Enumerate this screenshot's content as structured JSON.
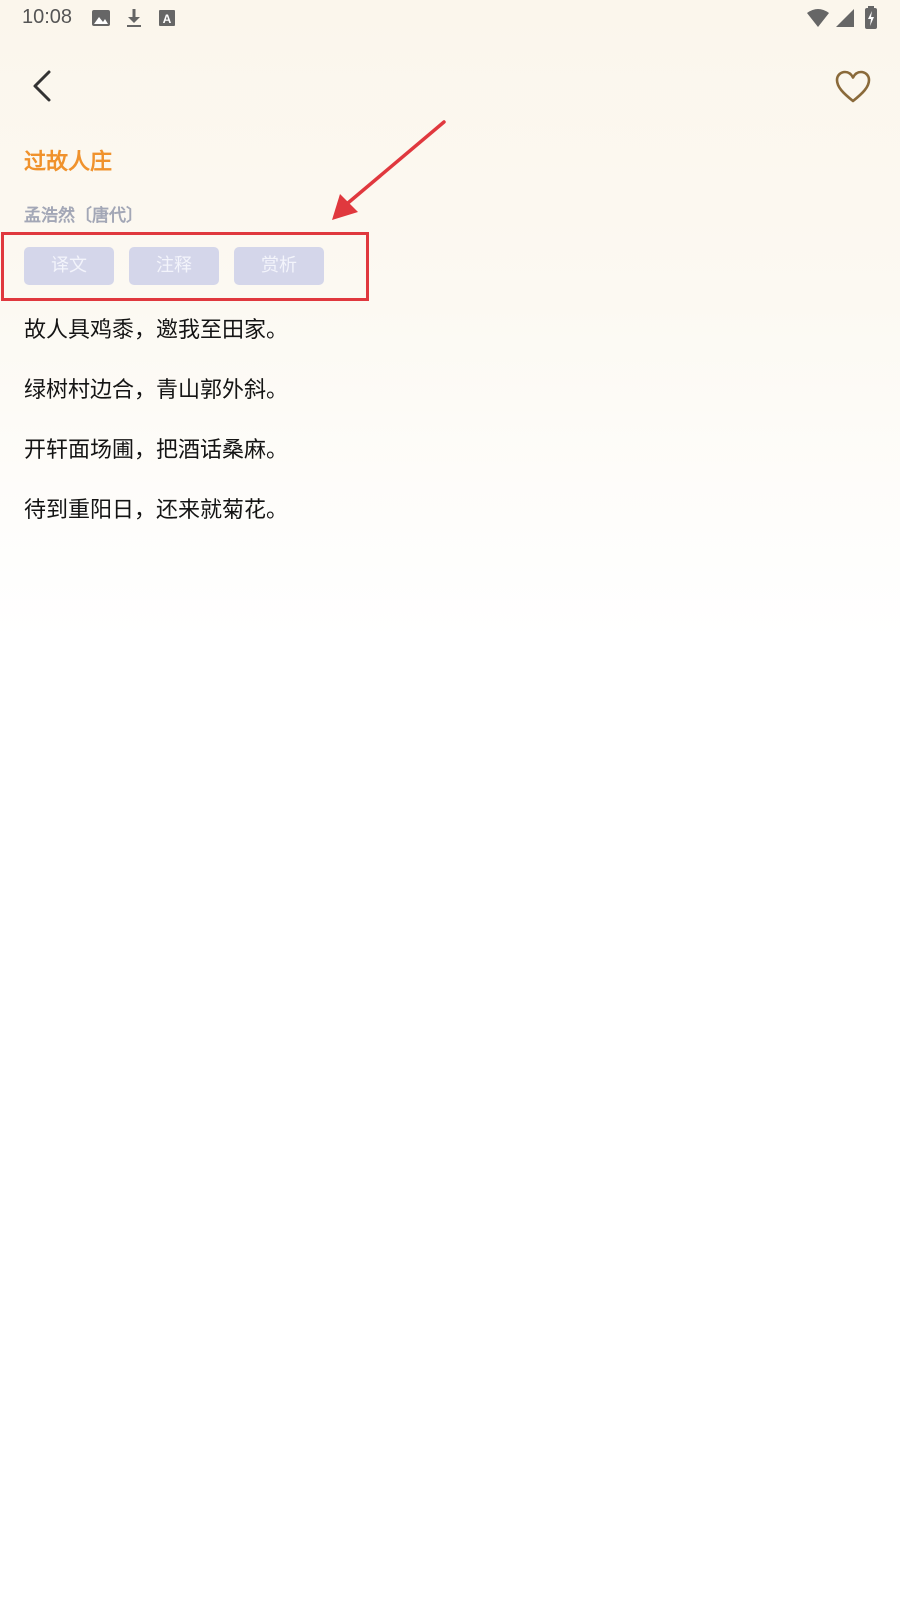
{
  "status_bar": {
    "time": "10:08",
    "left_icons": [
      "image-icon",
      "download-icon",
      "text-a-icon"
    ],
    "right_icons": [
      "wifi-icon",
      "signal-icon",
      "battery-charging-icon"
    ]
  },
  "nav": {
    "back_icon": "chevron-left-icon",
    "favorite_icon": "heart-outline-icon",
    "favorite_color": "#8a6a3a"
  },
  "poem": {
    "title": "过故人庄",
    "author": "孟浩然〔唐代〕",
    "lines": [
      "故人具鸡黍，邀我至田家。",
      "绿树村边合，青山郭外斜。",
      "开轩面场圃，把酒话桑麻。",
      "待到重阳日，还来就菊花。"
    ]
  },
  "tabs": [
    {
      "label": "译文"
    },
    {
      "label": "注释"
    },
    {
      "label": "赏析"
    }
  ],
  "colors": {
    "title": "#f0922c",
    "author": "#a3a7b6",
    "tab_bg": "#d4d6ea",
    "tab_text": "#f3f4fb",
    "annotation": "#e0383e"
  }
}
